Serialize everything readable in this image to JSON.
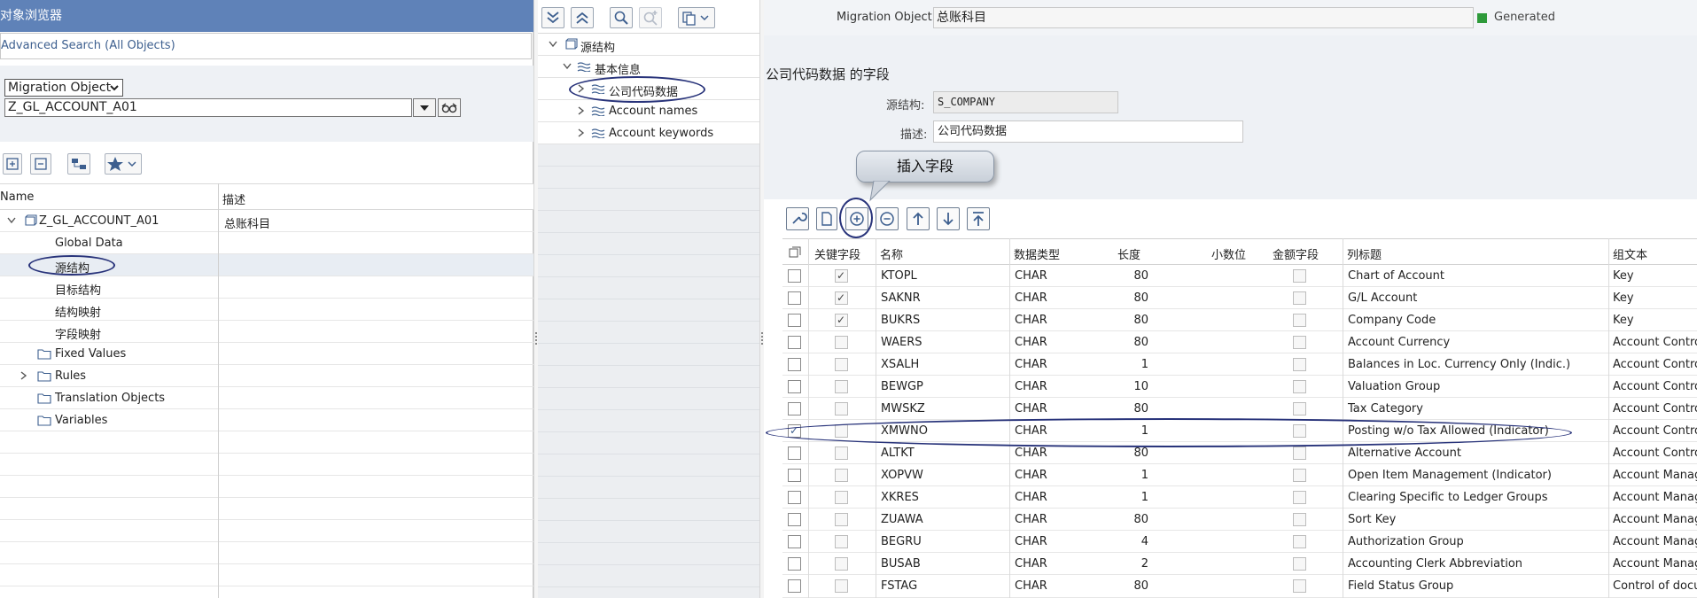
{
  "left": {
    "title": "对象浏览器",
    "advanced_search": "Advanced Search (All Objects)",
    "select_value": "Migration Object",
    "object_input": "Z_GL_ACCOUNT_A01",
    "tree_columns": {
      "name": "Name",
      "desc": "描述"
    },
    "tree": [
      {
        "label": "Z_GL_ACCOUNT_A01",
        "desc": "总账科目"
      },
      {
        "label": "Global Data",
        "desc": ""
      },
      {
        "label": "源结构",
        "desc": ""
      },
      {
        "label": "目标结构",
        "desc": ""
      },
      {
        "label": "结构映射",
        "desc": ""
      },
      {
        "label": "字段映射",
        "desc": ""
      },
      {
        "label": "Fixed Values",
        "desc": ""
      },
      {
        "label": "Rules",
        "desc": ""
      },
      {
        "label": "Translation Objects",
        "desc": ""
      },
      {
        "label": "Variables",
        "desc": ""
      }
    ]
  },
  "middle": {
    "tree": [
      {
        "label": "源结构"
      },
      {
        "label": "基本信息"
      },
      {
        "label": "公司代码数据"
      },
      {
        "label": "Account names"
      },
      {
        "label": "Account keywords"
      }
    ]
  },
  "right": {
    "migration_object_label": "Migration Object:",
    "migration_object_value": "总账科目",
    "status": "Generated",
    "status_color": "#2e9a3a",
    "section_title": "公司代码数据 的字段",
    "source_structure_label": "源结构:",
    "source_structure_value": "S_COMPANY",
    "description_label": "描述:",
    "description_value": "公司代码数据",
    "tooltip": "插入字段",
    "columns": {
      "key": "关键字段",
      "name": "名称",
      "type": "数据类型",
      "length": "长度",
      "decimals": "小数位",
      "amount": "金额字段",
      "heading": "列标题",
      "group": "组文本"
    },
    "rows": [
      {
        "selected": false,
        "key": true,
        "name": "KTOPL",
        "type": "CHAR",
        "length": "80",
        "heading": "Chart of Account",
        "group": "Key"
      },
      {
        "selected": false,
        "key": true,
        "name": "SAKNR",
        "type": "CHAR",
        "length": "80",
        "heading": "G/L Account",
        "group": "Key"
      },
      {
        "selected": false,
        "key": true,
        "name": "BUKRS",
        "type": "CHAR",
        "length": "80",
        "heading": "Company Code",
        "group": "Key"
      },
      {
        "selected": false,
        "key": false,
        "name": "WAERS",
        "type": "CHAR",
        "length": "80",
        "heading": "Account Currency",
        "group": "Account Contro"
      },
      {
        "selected": false,
        "key": false,
        "name": "XSALH",
        "type": "CHAR",
        "length": "1",
        "heading": "Balances in Loc. Currency Only (Indic.)",
        "group": "Account Contro"
      },
      {
        "selected": false,
        "key": false,
        "name": "BEWGP",
        "type": "CHAR",
        "length": "10",
        "heading": "Valuation Group",
        "group": "Account Contro"
      },
      {
        "selected": false,
        "key": false,
        "name": "MWSKZ",
        "type": "CHAR",
        "length": "80",
        "heading": "Tax Category",
        "group": "Account Contro"
      },
      {
        "selected": true,
        "key": false,
        "name": "XMWNO",
        "type": "CHAR",
        "length": "1",
        "heading": "Posting w/o Tax Allowed (Indicator)",
        "group": "Account Contro"
      },
      {
        "selected": false,
        "key": false,
        "name": "ALTKT",
        "type": "CHAR",
        "length": "80",
        "heading": "Alternative Account",
        "group": "Account Contro"
      },
      {
        "selected": false,
        "key": false,
        "name": "XOPVW",
        "type": "CHAR",
        "length": "1",
        "heading": "Open Item Management (Indicator)",
        "group": "Account Manag"
      },
      {
        "selected": false,
        "key": false,
        "name": "XKRES",
        "type": "CHAR",
        "length": "1",
        "heading": "Clearing Specific to Ledger Groups",
        "group": "Account Manag"
      },
      {
        "selected": false,
        "key": false,
        "name": "ZUAWA",
        "type": "CHAR",
        "length": "80",
        "heading": "Sort Key",
        "group": "Account Manag"
      },
      {
        "selected": false,
        "key": false,
        "name": "BEGRU",
        "type": "CHAR",
        "length": "4",
        "heading": "Authorization Group",
        "group": "Account Manag"
      },
      {
        "selected": false,
        "key": false,
        "name": "BUSAB",
        "type": "CHAR",
        "length": "2",
        "heading": "Accounting Clerk Abbreviation",
        "group": "Account Manag"
      },
      {
        "selected": false,
        "key": false,
        "name": "FSTAG",
        "type": "CHAR",
        "length": "80",
        "heading": "Field Status Group",
        "group": "Control of docu"
      }
    ]
  },
  "colors": {
    "title_bar": "#5f82b8",
    "annotation": "#28337a",
    "panel_bg": "#eef1f5"
  }
}
